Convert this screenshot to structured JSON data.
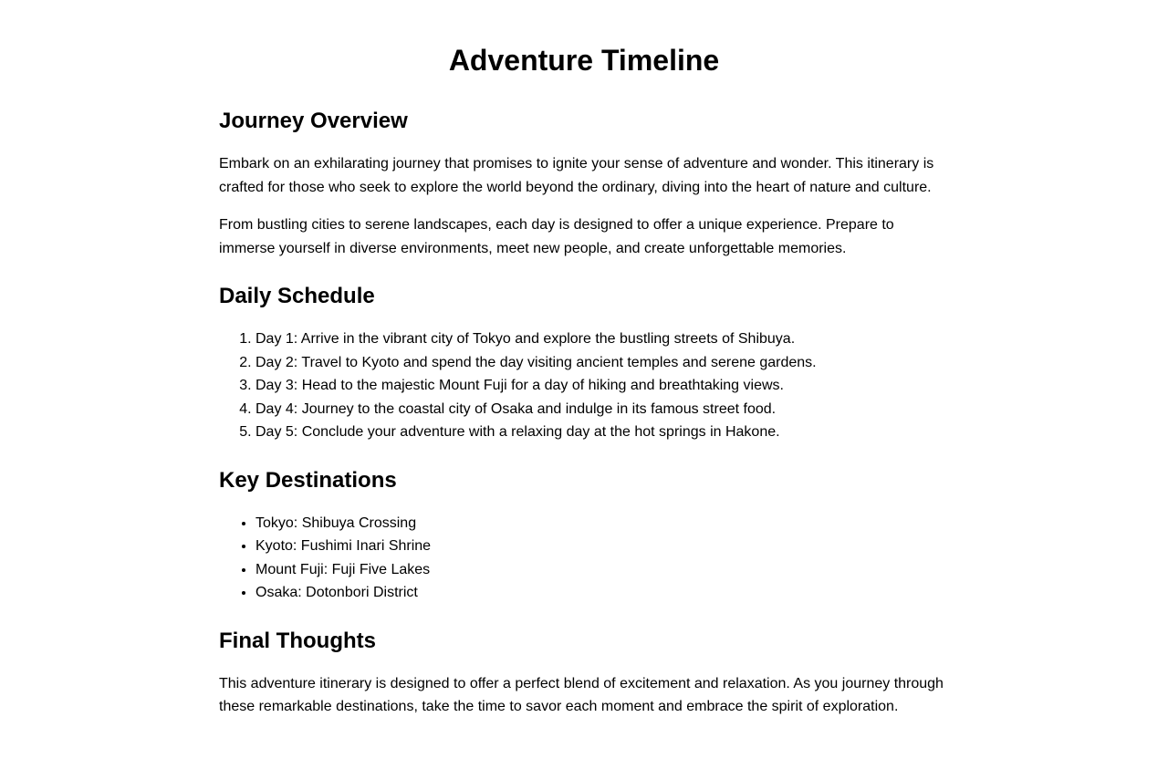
{
  "title": "Adventure Timeline",
  "overview": {
    "heading": "Journey Overview",
    "paragraphs": [
      "Embark on an exhilarating journey that promises to ignite your sense of adventure and wonder. This itinerary is crafted for those who seek to explore the world beyond the ordinary, diving into the heart of nature and culture.",
      "From bustling cities to serene landscapes, each day is designed to offer a unique experience. Prepare to immerse yourself in diverse environments, meet new people, and create unforgettable memories."
    ]
  },
  "schedule": {
    "heading": "Daily Schedule",
    "items": [
      "Day 1: Arrive in the vibrant city of Tokyo and explore the bustling streets of Shibuya.",
      "Day 2: Travel to Kyoto and spend the day visiting ancient temples and serene gardens.",
      "Day 3: Head to the majestic Mount Fuji for a day of hiking and breathtaking views.",
      "Day 4: Journey to the coastal city of Osaka and indulge in its famous street food.",
      "Day 5: Conclude your adventure with a relaxing day at the hot springs in Hakone."
    ]
  },
  "destinations": {
    "heading": "Key Destinations",
    "items": [
      "Tokyo: Shibuya Crossing",
      "Kyoto: Fushimi Inari Shrine",
      "Mount Fuji: Fuji Five Lakes",
      "Osaka: Dotonbori District"
    ]
  },
  "final": {
    "heading": "Final Thoughts",
    "paragraphs": [
      "This adventure itinerary is designed to offer a perfect blend of excitement and relaxation. As you journey through these remarkable destinations, take the time to savor each moment and embrace the spirit of exploration."
    ]
  }
}
